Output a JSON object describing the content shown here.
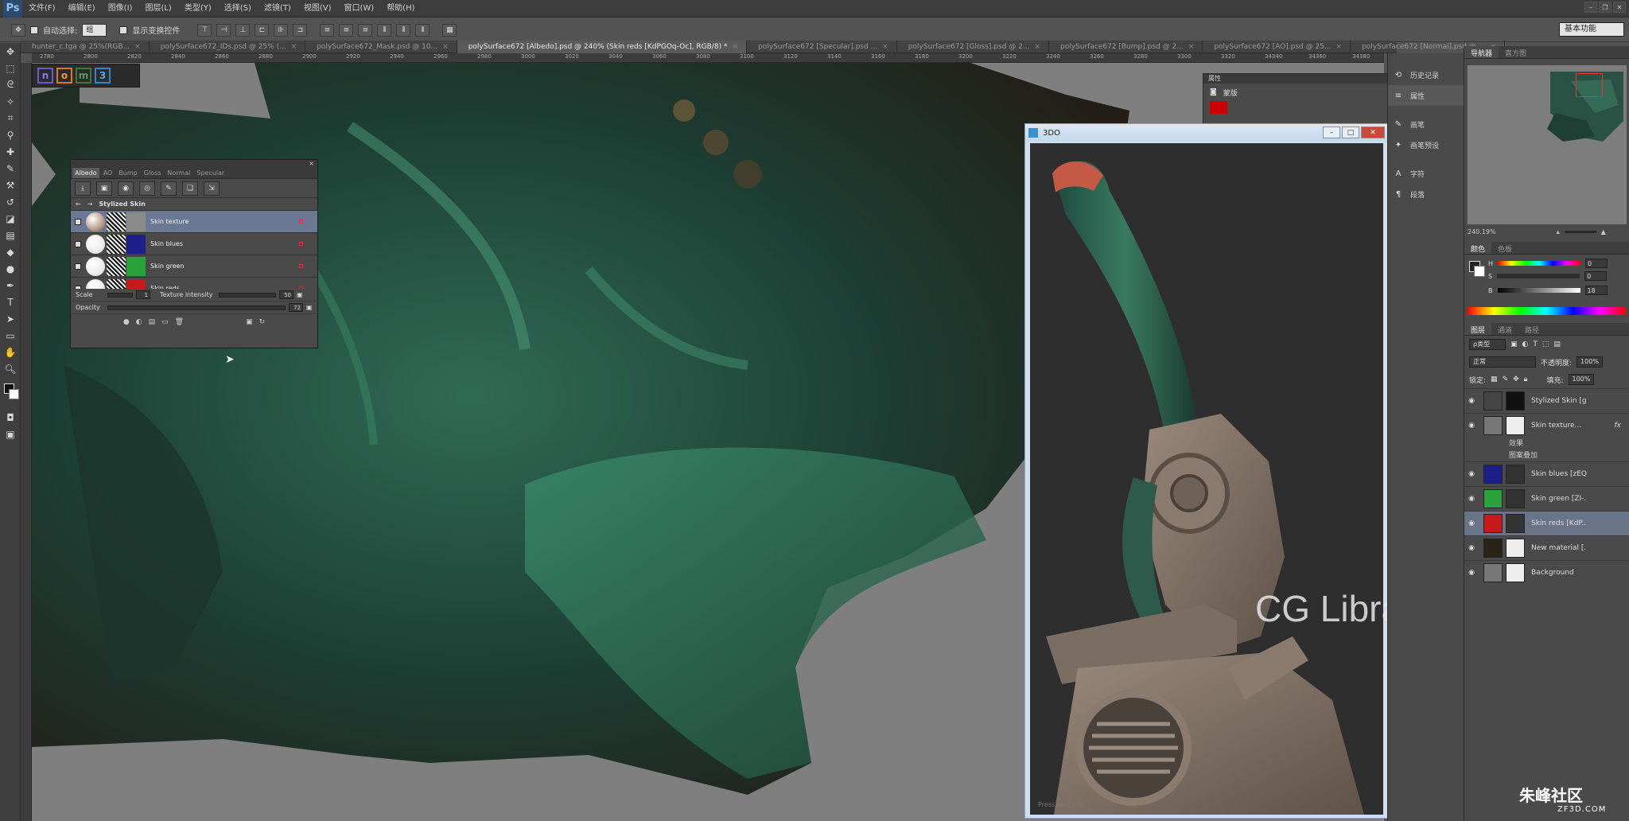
{
  "app": {
    "logo": "Ps"
  },
  "menu": [
    "文件(F)",
    "编辑(E)",
    "图像(I)",
    "图层(L)",
    "类型(Y)",
    "选择(S)",
    "滤镜(T)",
    "视图(V)",
    "窗口(W)",
    "帮助(H)"
  ],
  "options_bar": {
    "auto_select_label": "自动选择:",
    "auto_select_value": "组",
    "show_transform_label": "显示变换控件",
    "workspace": "基本功能"
  },
  "tabs": [
    {
      "label": "hunter_c.tga @ 25%(RGB..."
    },
    {
      "label": "polySurface672_IDs.psd @ 25% (..."
    },
    {
      "label": "polySurface672_Mask.psd @ 10..."
    },
    {
      "label": "polySurface672 [Albedo].psd @ 240% (Skin reds [KdPGOq-Oc], RGB/8) *"
    },
    {
      "label": "polySurface672 [Specular].psd ..."
    },
    {
      "label": "polySurface672 [Gloss].psd @ 2..."
    },
    {
      "label": "polySurface672 [Bump].psd @ 2..."
    },
    {
      "label": "polySurface672 [AO].psd @ 25..."
    },
    {
      "label": "polySurface672 [Normal].psd @ ..."
    }
  ],
  "ruler_ticks": [
    "2780",
    "2800",
    "2820",
    "2840",
    "2860",
    "2880",
    "2900",
    "2920",
    "2940",
    "2960",
    "2980",
    "3000",
    "3020",
    "3040",
    "3060",
    "3080",
    "3100",
    "3120",
    "3140",
    "3160",
    "3180",
    "3200",
    "3220",
    "3240",
    "3260",
    "3280",
    "3300",
    "3320",
    "34340",
    "34360",
    "34380"
  ],
  "mini_tools": [
    {
      "letter": "n",
      "color": "#6a5acd"
    },
    {
      "letter": "o",
      "color": "#e07a20"
    },
    {
      "letter": "m",
      "color": "#3a7a3a"
    },
    {
      "letter": "3",
      "color": "#2a8ad0"
    }
  ],
  "material_panel": {
    "tabs": [
      "Albedo",
      "AO",
      "Bump",
      "Gloss",
      "Normal",
      "Specular"
    ],
    "breadcrumb": "Stylized Skin",
    "layers": [
      {
        "name": "Skin texture",
        "color": "#8a8a8a",
        "sphere": "#8a5a3a"
      },
      {
        "name": "Skin blues",
        "color": "#1a1f8a",
        "sphere": "#e0e0e0"
      },
      {
        "name": "Skin green",
        "color": "#2aa23a",
        "sphere": "#e0e0e0"
      },
      {
        "name": "Skin reds",
        "color": "#c81a1a",
        "sphere": "#e0e0e0"
      }
    ],
    "scale_label": "Scale",
    "scale_value": "1",
    "intensity_label": "Texture intensity",
    "intensity_value": "50",
    "opacity_label": "Opacity",
    "opacity_value": "72"
  },
  "props_panel": {
    "header": "属性",
    "row": "蒙版"
  },
  "win3do": {
    "title": "3DO",
    "footer": "Press space to ..."
  },
  "watermark": "CG Library",
  "dock": [
    {
      "icon": "history-icon",
      "glyph": "⟲",
      "label": "历史记录"
    },
    {
      "icon": "properties-icon",
      "glyph": "≡",
      "label": "属性"
    },
    {
      "icon": "brush-icon",
      "glyph": "✎",
      "label": "画笔"
    },
    {
      "icon": "brush-presets-icon",
      "glyph": "✦",
      "label": "画笔预设"
    },
    {
      "icon": "character-icon",
      "glyph": "A",
      "label": "字符"
    },
    {
      "icon": "paragraph-icon",
      "glyph": "¶",
      "label": "段落"
    }
  ],
  "right": {
    "nav_tabs": [
      "导航器",
      "直方图"
    ],
    "zoom": "240.19%",
    "color_tabs": [
      "颜色",
      "色板"
    ],
    "h": "0",
    "s": "0",
    "b": "18",
    "layers_tabs": [
      "图层",
      "通道",
      "路径"
    ],
    "filter": "ρ类型",
    "blend": "正常",
    "opacity_label": "不透明度:",
    "opacity": "100%",
    "lock_label": "锁定:",
    "fill_label": "填充:",
    "fill": "100%",
    "layers": [
      {
        "name": "Stylized Skin [gww...",
        "thumb": "#444",
        "mask": "#111"
      },
      {
        "name": "Skin texture...",
        "thumb": "#777",
        "mask": "#eee",
        "fx": "fx"
      },
      {
        "name": "Skin blues [zEQ...",
        "thumb": "#1a1f8a",
        "mask": "#333"
      },
      {
        "name": "Skin green [ZI-...",
        "thumb": "#2aa23a",
        "mask": "#333"
      },
      {
        "name": "Skin reds [KdP...",
        "thumb": "#c81a1a",
        "mask": "#333"
      },
      {
        "name": "New material [...",
        "thumb": "#2a2318",
        "mask": "#eee"
      },
      {
        "name": "Background",
        "thumb": "#777",
        "mask": "#eee"
      }
    ],
    "effects_label": "效果",
    "pattern_overlay": "图案叠加"
  },
  "brand": {
    "name": "朱峰社区",
    "sub": "ZF3D.COM"
  }
}
